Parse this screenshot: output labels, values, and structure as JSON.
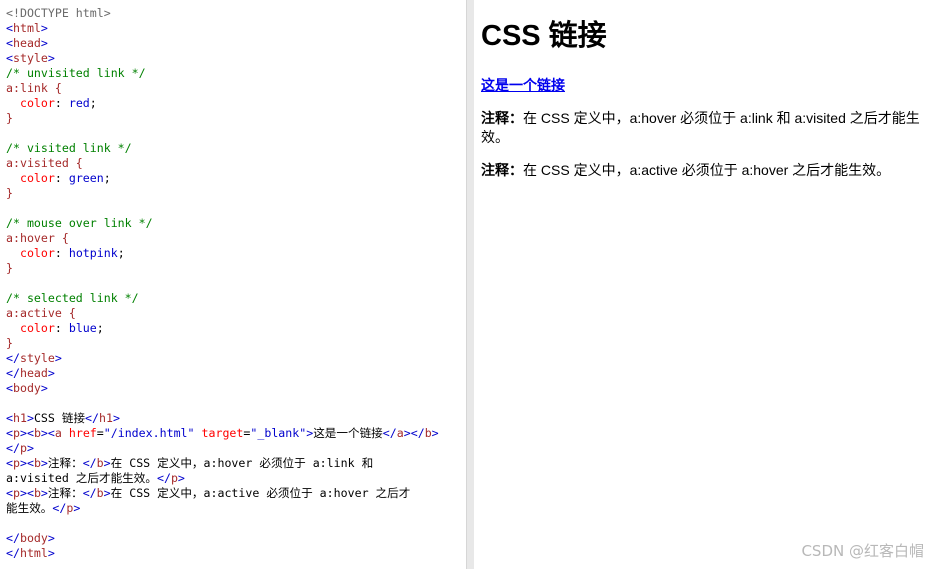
{
  "code_lines": [
    [
      [
        "<!DOCTYPE html>",
        "dt"
      ]
    ],
    [
      [
        "<",
        "br"
      ],
      [
        "html",
        "tg"
      ],
      [
        ">",
        "br"
      ]
    ],
    [
      [
        "<",
        "br"
      ],
      [
        "head",
        "tg"
      ],
      [
        ">",
        "br"
      ]
    ],
    [
      [
        "<",
        "br"
      ],
      [
        "style",
        "tg"
      ],
      [
        ">",
        "br"
      ]
    ],
    [
      [
        "/* unvisited link */",
        "cm"
      ]
    ],
    [
      [
        "a:link {",
        "sl"
      ]
    ],
    [
      [
        "  color",
        "pr"
      ],
      [
        ": ",
        "tx"
      ],
      [
        "red",
        "vl"
      ],
      [
        ";",
        "tx"
      ]
    ],
    [
      [
        "}",
        "sl"
      ]
    ],
    [
      [
        "",
        ""
      ]
    ],
    [
      [
        "/* visited link */",
        "cm"
      ]
    ],
    [
      [
        "a:visited {",
        "sl"
      ]
    ],
    [
      [
        "  color",
        "pr"
      ],
      [
        ": ",
        "tx"
      ],
      [
        "green",
        "vl"
      ],
      [
        ";",
        "tx"
      ]
    ],
    [
      [
        "}",
        "sl"
      ]
    ],
    [
      [
        "",
        ""
      ]
    ],
    [
      [
        "/* mouse over link */",
        "cm"
      ]
    ],
    [
      [
        "a:hover {",
        "sl"
      ]
    ],
    [
      [
        "  color",
        "pr"
      ],
      [
        ": ",
        "tx"
      ],
      [
        "hotpink",
        "vl"
      ],
      [
        ";",
        "tx"
      ]
    ],
    [
      [
        "}",
        "sl"
      ]
    ],
    [
      [
        "",
        ""
      ]
    ],
    [
      [
        "/* selected link */",
        "cm"
      ]
    ],
    [
      [
        "a:active {",
        "sl"
      ]
    ],
    [
      [
        "  color",
        "pr"
      ],
      [
        ": ",
        "tx"
      ],
      [
        "blue",
        "vl"
      ],
      [
        ";",
        "tx"
      ]
    ],
    [
      [
        "}",
        "sl"
      ]
    ],
    [
      [
        "</",
        "br"
      ],
      [
        "style",
        "tg"
      ],
      [
        ">",
        "br"
      ]
    ],
    [
      [
        "</",
        "br"
      ],
      [
        "head",
        "tg"
      ],
      [
        ">",
        "br"
      ]
    ],
    [
      [
        "<",
        "br"
      ],
      [
        "body",
        "tg"
      ],
      [
        ">",
        "br"
      ]
    ],
    [
      [
        "",
        ""
      ]
    ],
    [
      [
        "<",
        "br"
      ],
      [
        "h1",
        "tg"
      ],
      [
        ">",
        "br"
      ],
      [
        "CSS 链接",
        "tx"
      ],
      [
        "</",
        "br"
      ],
      [
        "h1",
        "tg"
      ],
      [
        ">",
        "br"
      ]
    ],
    [
      [
        "<",
        "br"
      ],
      [
        "p",
        "tg"
      ],
      [
        "><",
        "br"
      ],
      [
        "b",
        "tg"
      ],
      [
        "><",
        "br"
      ],
      [
        "a ",
        "tg"
      ],
      [
        "href",
        "at"
      ],
      [
        "=",
        "tx"
      ],
      [
        "\"/index.html\"",
        "av"
      ],
      [
        " ",
        "tx"
      ],
      [
        "target",
        "at"
      ],
      [
        "=",
        "tx"
      ],
      [
        "\"_blank\"",
        "av"
      ],
      [
        ">",
        "br"
      ],
      [
        "这是一个链接",
        "tx"
      ],
      [
        "</",
        "br"
      ],
      [
        "a",
        "tg"
      ],
      [
        "></",
        "br"
      ],
      [
        "b",
        "tg"
      ],
      [
        ">",
        "br"
      ]
    ],
    [
      [
        "</",
        "br"
      ],
      [
        "p",
        "tg"
      ],
      [
        ">",
        "br"
      ]
    ],
    [
      [
        "<",
        "br"
      ],
      [
        "p",
        "tg"
      ],
      [
        "><",
        "br"
      ],
      [
        "b",
        "tg"
      ],
      [
        ">",
        "br"
      ],
      [
        "注释：",
        "tx"
      ],
      [
        "</",
        "br"
      ],
      [
        "b",
        "tg"
      ],
      [
        ">",
        "br"
      ],
      [
        "在 CSS 定义中，a:hover 必须位于 a:link 和",
        "tx"
      ]
    ],
    [
      [
        "a:visited 之后才能生效。",
        "tx"
      ],
      [
        "</",
        "br"
      ],
      [
        "p",
        "tg"
      ],
      [
        ">",
        "br"
      ]
    ],
    [
      [
        "<",
        "br"
      ],
      [
        "p",
        "tg"
      ],
      [
        "><",
        "br"
      ],
      [
        "b",
        "tg"
      ],
      [
        ">",
        "br"
      ],
      [
        "注释：",
        "tx"
      ],
      [
        "</",
        "br"
      ],
      [
        "b",
        "tg"
      ],
      [
        ">",
        "br"
      ],
      [
        "在 CSS 定义中，a:active 必须位于 a:hover 之后才",
        "tx"
      ]
    ],
    [
      [
        "能生效。",
        "tx"
      ],
      [
        "</",
        "br"
      ],
      [
        "p",
        "tg"
      ],
      [
        ">",
        "br"
      ]
    ],
    [
      [
        "",
        ""
      ]
    ],
    [
      [
        "</",
        "br"
      ],
      [
        "body",
        "tg"
      ],
      [
        ">",
        "br"
      ]
    ],
    [
      [
        "</",
        "br"
      ],
      [
        "html",
        "tg"
      ],
      [
        ">",
        "br"
      ]
    ]
  ],
  "result": {
    "heading": "CSS 链接",
    "link": "这是一个链接",
    "note_label": "注释：",
    "note1": "在 CSS 定义中，a:hover 必须位于 a:link 和 a:visited 之后才能生效。",
    "note2": "在 CSS 定义中，a:active 必须位于 a:hover 之后才能生效。"
  },
  "watermark": "CSDN @红客白帽"
}
